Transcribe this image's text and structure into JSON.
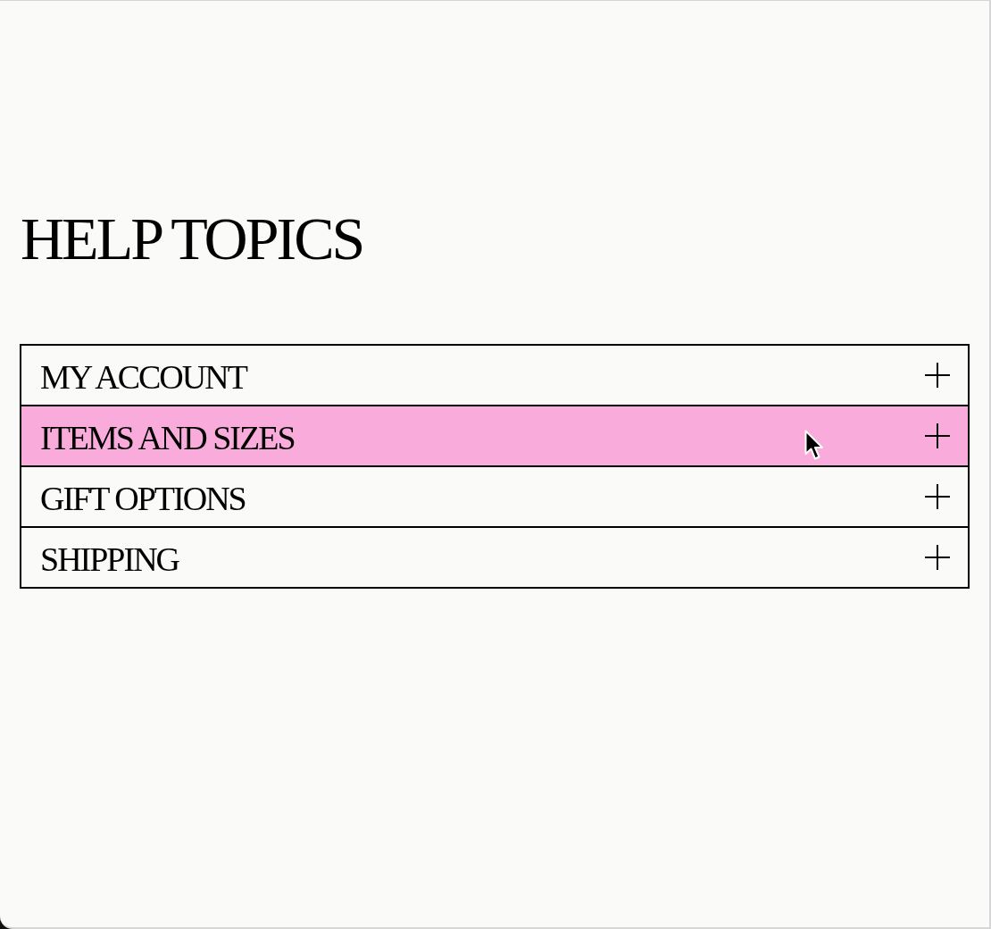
{
  "title": "HELP TOPICS",
  "topics": [
    {
      "label": "MY ACCOUNT",
      "expanded": false,
      "hovered": false
    },
    {
      "label": "ITEMS AND SIZES",
      "expanded": false,
      "hovered": true
    },
    {
      "label": "GIFT OPTIONS",
      "expanded": false,
      "hovered": false
    },
    {
      "label": "SHIPPING",
      "expanded": false,
      "hovered": false
    }
  ]
}
